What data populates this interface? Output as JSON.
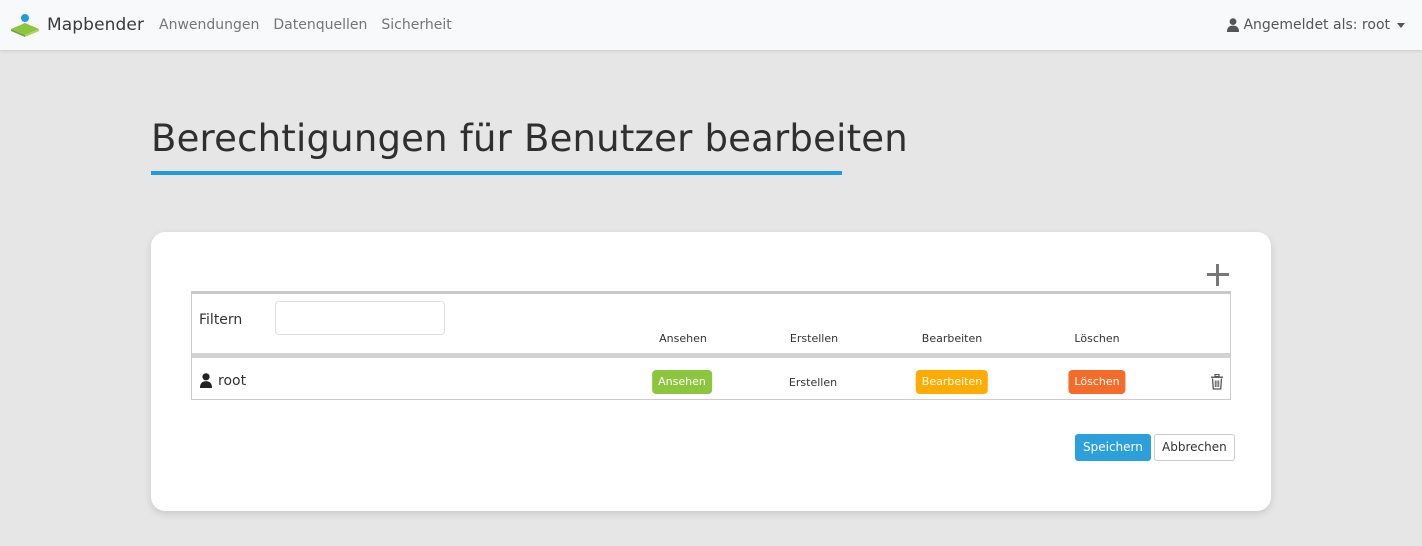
{
  "app": {
    "brand": "Mapbender",
    "nav": [
      "Anwendungen",
      "Datenquellen",
      "Sicherheit"
    ],
    "user_menu": "Angemeldet als: root"
  },
  "page": {
    "title": "Berechtigungen für Benutzer bearbeiten",
    "accent_color": "#1d9ce0"
  },
  "table": {
    "filter_label": "Filtern",
    "filter_value": "",
    "columns": [
      "Ansehen",
      "Erstellen",
      "Bearbeiten",
      "Löschen"
    ],
    "rows": [
      {
        "name": "root",
        "icon": "user-icon",
        "permissions": {
          "view": {
            "label": "Ansehen",
            "active": true,
            "color": "#8cc63f"
          },
          "create": {
            "label": "Erstellen",
            "active": false
          },
          "edit": {
            "label": "Bearbeiten",
            "active": true,
            "color": "#ffab00"
          },
          "delete": {
            "label": "Löschen",
            "active": true,
            "color": "#f46b2a"
          }
        }
      }
    ]
  },
  "actions": {
    "save": "Speichern",
    "cancel": "Abbrechen"
  },
  "icons": [
    "mapbender-logo",
    "user-icon",
    "caret-down-icon",
    "plus-icon",
    "trash-icon"
  ]
}
